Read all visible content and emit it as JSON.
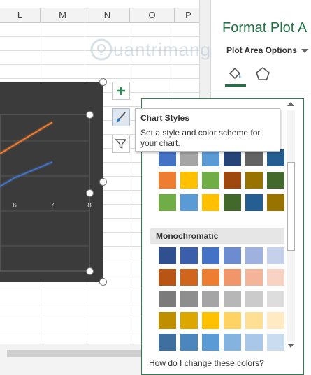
{
  "sheet": {
    "columns": [
      "L",
      "M",
      "N",
      "O",
      "P"
    ]
  },
  "chart": {
    "x_tick_labels": [
      "6",
      "7",
      "8"
    ]
  },
  "side_buttons": {
    "elements_icon": "plus-icon",
    "styles_icon": "paintbrush-icon",
    "filters_icon": "funnel-icon"
  },
  "format_pane": {
    "title": "Format Plot A",
    "tab_label": "Plot Area Options",
    "icons": [
      "paint-bucket-icon",
      "pentagon-icon"
    ],
    "accent_color": "#217346"
  },
  "watermark": {
    "text": "uantrimang"
  },
  "tooltip": {
    "title": "Chart Styles",
    "body": "Set a style and color scheme for your chart."
  },
  "gallery": {
    "colorful_rows": [
      [
        "#4472c4",
        "#a5a5a5",
        "#5b9bd5",
        "#264478",
        "#636363",
        "#255e91"
      ],
      [
        "#ed7d31",
        "#ffc000",
        "#70ad47",
        "#9e480e",
        "#997300",
        "#43682b"
      ],
      [
        "#70ad47",
        "#5b9bd5",
        "#ffc000",
        "#43682b",
        "#255e91",
        "#997300"
      ]
    ],
    "group_header": "Monochromatic",
    "mono_rows": [
      [
        "#2f4f8f",
        "#3b5eab",
        "#4472c4",
        "#6d8ccf",
        "#9fb1de",
        "#c5d0ea"
      ],
      [
        "#b85514",
        "#d0661d",
        "#ed7d31",
        "#f0966a",
        "#f4b49a",
        "#f8d2c3"
      ],
      [
        "#7b7b7b",
        "#8e8e8e",
        "#a5a5a5",
        "#b7b7b7",
        "#cbcbcb",
        "#dddddd"
      ],
      [
        "#bf8f00",
        "#dca800",
        "#ffc000",
        "#ffd363",
        "#ffdf94",
        "#ffeac4"
      ],
      [
        "#3e6f9e",
        "#4b86bc",
        "#5b9bd5",
        "#84b3e0",
        "#a9c8e9",
        "#c9dcf0"
      ]
    ],
    "help_text": "How do I change these colors?"
  }
}
